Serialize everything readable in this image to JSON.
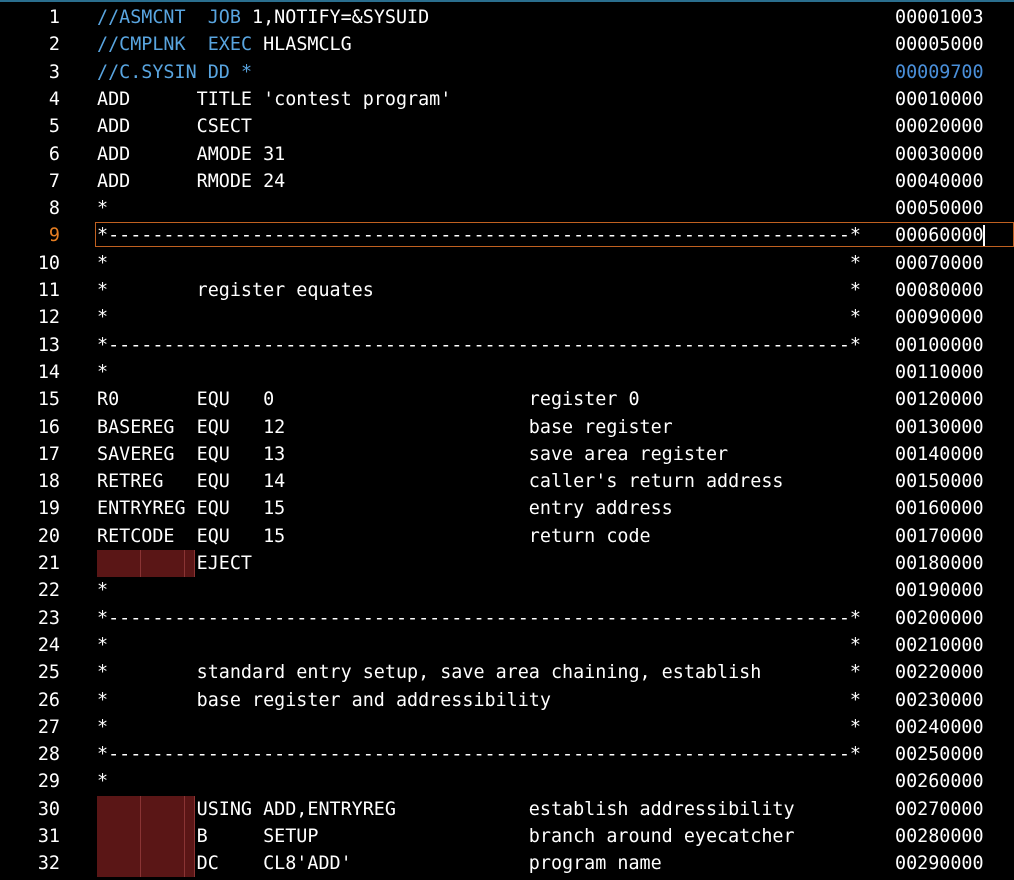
{
  "editor": {
    "active_line": 9,
    "lines": [
      {
        "n": "1",
        "code": "//ASMCNT  JOB 1,NOTIFY=&SYSUID",
        "seq": "00001003",
        "kind": "jcl"
      },
      {
        "n": "2",
        "code": "//CMPLNK  EXEC HLASMCLG",
        "seq": "00005000",
        "kind": "jcl"
      },
      {
        "n": "3",
        "code": "//C.SYSIN DD *",
        "seq": "00009700",
        "kind": "jcl-blue"
      },
      {
        "n": "4",
        "code": "ADD      TITLE 'contest program'",
        "seq": "00010000"
      },
      {
        "n": "5",
        "code": "ADD      CSECT",
        "seq": "00020000"
      },
      {
        "n": "6",
        "code": "ADD      AMODE 31",
        "seq": "00030000"
      },
      {
        "n": "7",
        "code": "ADD      RMODE 24",
        "seq": "00040000"
      },
      {
        "n": "8",
        "code": "*",
        "seq": "00050000"
      },
      {
        "n": "9",
        "code": "*-------------------------------------------------------------------*",
        "seq": "00060000"
      },
      {
        "n": "10",
        "code": "*                                                                   *",
        "seq": "00070000"
      },
      {
        "n": "11",
        "code": "*        register equates                                           *",
        "seq": "00080000"
      },
      {
        "n": "12",
        "code": "*                                                                   *",
        "seq": "00090000"
      },
      {
        "n": "13",
        "code": "*-------------------------------------------------------------------*",
        "seq": "00100000"
      },
      {
        "n": "14",
        "code": "*",
        "seq": "00110000"
      },
      {
        "n": "15",
        "code": "R0       EQU   0                       register 0",
        "seq": "00120000"
      },
      {
        "n": "16",
        "code": "BASEREG  EQU   12                      base register",
        "seq": "00130000"
      },
      {
        "n": "17",
        "code": "SAVEREG  EQU   13                      save area register",
        "seq": "00140000"
      },
      {
        "n": "18",
        "code": "RETREG   EQU   14                      caller's return address",
        "seq": "00150000"
      },
      {
        "n": "19",
        "code": "ENTRYREG EQU   15                      entry address",
        "seq": "00160000"
      },
      {
        "n": "20",
        "code": "RETCODE  EQU   15                      return code",
        "seq": "00170000"
      },
      {
        "n": "21",
        "code": "         EJECT",
        "seq": "00180000",
        "tabs": true
      },
      {
        "n": "22",
        "code": "*",
        "seq": "00190000"
      },
      {
        "n": "23",
        "code": "*-------------------------------------------------------------------*",
        "seq": "00200000"
      },
      {
        "n": "24",
        "code": "*                                                                   *",
        "seq": "00210000"
      },
      {
        "n": "25",
        "code": "*        standard entry setup, save area chaining, establish        *",
        "seq": "00220000"
      },
      {
        "n": "26",
        "code": "*        base register and addressibility                           *",
        "seq": "00230000"
      },
      {
        "n": "27",
        "code": "*                                                                   *",
        "seq": "00240000"
      },
      {
        "n": "28",
        "code": "*-------------------------------------------------------------------*",
        "seq": "00250000"
      },
      {
        "n": "29",
        "code": "*",
        "seq": "00260000"
      },
      {
        "n": "30",
        "code": "         USING ADD,ENTRYREG            establish addressibility",
        "seq": "00270000",
        "tabs": true
      },
      {
        "n": "31",
        "code": "         B     SETUP                   branch around eyecatcher",
        "seq": "00280000",
        "tabs": true
      },
      {
        "n": "32",
        "code": "         DC    CL8'ADD'                program name",
        "seq": "00290000",
        "tabs": true
      }
    ]
  },
  "colors": {
    "background": "#000000",
    "text": "#ffffff",
    "keyword": "#59a5e0",
    "active_line_number": "#e67e22",
    "tab_marker": "#5a1616"
  }
}
